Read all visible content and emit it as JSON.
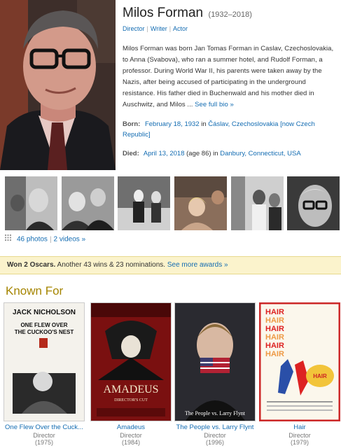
{
  "person": {
    "name": "Milos Forman",
    "years": "(1932–2018)",
    "roles": [
      "Director",
      "Writer",
      "Actor"
    ],
    "bio": "Milos Forman was born Jan Tomas Forman in Caslav, Czechoslovakia, to Anna (Svabova), who ran a summer hotel, and Rudolf Forman, a professor. During World War II, his parents were taken away by the Nazis, after being accused of participating in the underground resistance. His father died in Buchenwald and his mother died in Auschwitz, and Milos ...",
    "bio_more": "See full bio »",
    "born_label": "Born:",
    "born_date": "February 18, 1932",
    "born_in": "in",
    "born_place_1": "Čáslav,",
    "born_place_2": "Czechoslovakia [now Czech Republic]",
    "died_label": "Died:",
    "died_date": "April 13, 2018",
    "died_age": "(age 86) in",
    "died_place": "Danbury, Connecticut, USA"
  },
  "media": {
    "photos": "46 photos",
    "videos": "2 videos »"
  },
  "awards": {
    "bold": "Won 2 Oscars.",
    "text": "Another 43 wins & 23 nominations.",
    "link": "See more awards »"
  },
  "known_for": {
    "title": "Known For",
    "items": [
      {
        "title": "One Flew Over the Cuck...",
        "role": "Director",
        "year": "(1975)"
      },
      {
        "title": "Amadeus",
        "role": "Director",
        "year": "(1984)"
      },
      {
        "title": "The People vs. Larry Flynt",
        "role": "Director",
        "year": "(1996)"
      },
      {
        "title": "Hair",
        "role": "Director",
        "year": "(1979)"
      }
    ],
    "poster_text": {
      "p1_top": "JACK NICHOLSON",
      "p1_title": "ONE FLEW OVER THE CUCKOO'S NEST",
      "p2_title": "AMADEUS",
      "p2_sub": "DIRECTOR'S CUT",
      "p3_title": "The People vs. Larry Flynt",
      "p4_word": "HAIR"
    }
  },
  "colors": {
    "link": "#136cb2",
    "award_bg": "#fbf3cc",
    "known_for_title": "#a58500"
  }
}
